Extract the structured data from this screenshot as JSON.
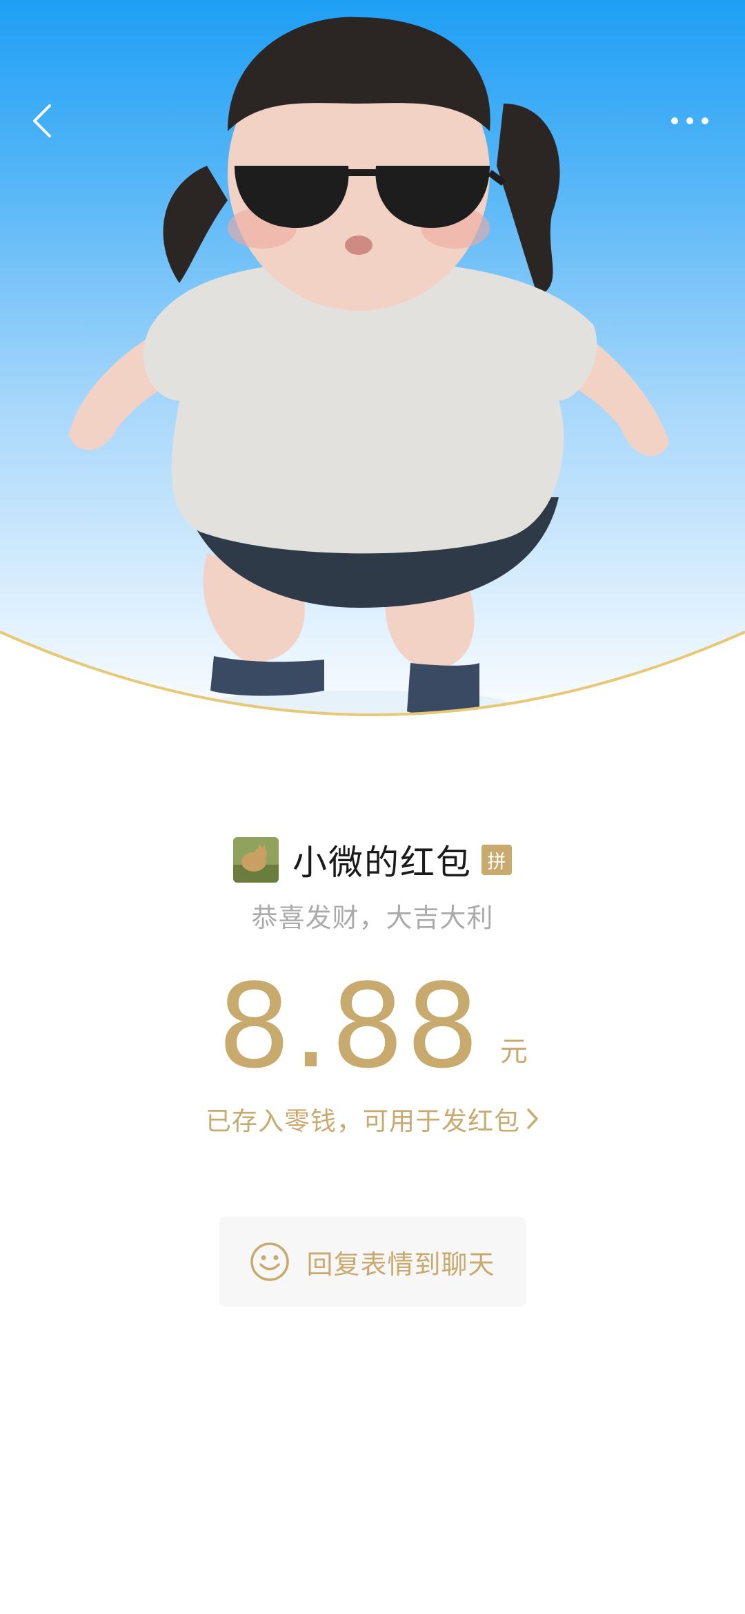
{
  "header": {
    "back_icon": "chevron-left-icon",
    "more_icon": "more-dots-icon"
  },
  "envelope": {
    "sender_name": "小微的红包",
    "pin_badge": "拼",
    "greeting": "恭喜发财，大吉大利",
    "amount": "8.88",
    "unit": "元",
    "stored_text": "已存入零钱，可用于发红包"
  },
  "reply": {
    "label": "回复表情到聊天",
    "icon": "smiley-icon"
  },
  "colors": {
    "accent": "#c8a96e",
    "header_blue": "#1e9ff5",
    "curve_gold": "#e6c877"
  }
}
